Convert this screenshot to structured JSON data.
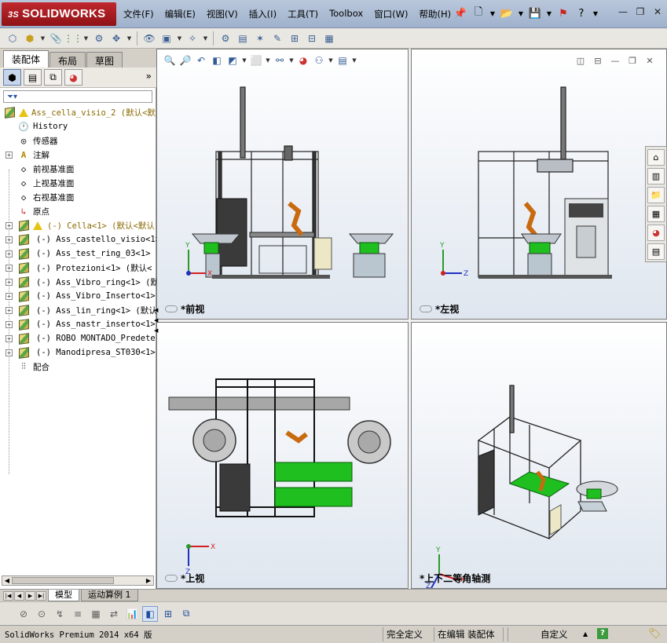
{
  "app": {
    "logo_text": "SOLIDWORKS",
    "logo_prefix": "3S"
  },
  "menu": {
    "items": [
      "文件(F)",
      "编辑(E)",
      "视图(V)",
      "插入(I)",
      "工具(T)",
      "Toolbox",
      "窗口(W)",
      "帮助(H)"
    ]
  },
  "titlebar_icons": [
    "pin-icon",
    "new-document-icon",
    "open-icon",
    "save-icon",
    "traffic-light-icon",
    "help-icon"
  ],
  "left_panel": {
    "tabs": [
      "装配体",
      "布局",
      "草图"
    ],
    "active_tab": "装配体",
    "tree": [
      {
        "label": "Ass_cella_visio_2  (默认<默",
        "icon": "assembly-icon",
        "warn": true,
        "type": "root"
      },
      {
        "label": "History",
        "icon": "history-icon"
      },
      {
        "label": "传感器",
        "icon": "sensor-icon"
      },
      {
        "label": "注解",
        "icon": "annotation-icon",
        "expand": true
      },
      {
        "label": "前视基准面",
        "icon": "plane-icon"
      },
      {
        "label": "上视基准面",
        "icon": "plane-icon"
      },
      {
        "label": "右视基准面",
        "icon": "plane-icon"
      },
      {
        "label": "原点",
        "icon": "origin-icon"
      },
      {
        "label": "(-) Cella<1> (默认<默认",
        "icon": "part-icon",
        "warn": true,
        "expand": true,
        "type": "cella"
      },
      {
        "label": "(-) Ass_castello_visio<1>",
        "icon": "part-icon",
        "expand": true
      },
      {
        "label": "(-) Ass_test_ring_03<1> (",
        "icon": "part-icon",
        "expand": true
      },
      {
        "label": "(-) Protezioni<1> (默认<",
        "icon": "part-icon",
        "expand": true
      },
      {
        "label": "(-) Ass_Vibro_ring<1> (默",
        "icon": "part-icon",
        "expand": true
      },
      {
        "label": "(-) Ass_Vibro_Inserto<1>",
        "icon": "part-icon",
        "expand": true
      },
      {
        "label": "(-) Ass_lin_ring<1> (默认",
        "icon": "part-icon",
        "expand": true
      },
      {
        "label": "(-) Ass_nastr_inserto<1>",
        "icon": "part-icon",
        "expand": true
      },
      {
        "label": "(-) ROBO MONTADO_Predeterm",
        "icon": "part-icon",
        "expand": true
      },
      {
        "label": "(-) Manodipresa_ST030<1>",
        "icon": "part-icon",
        "expand": true
      },
      {
        "label": "配合",
        "icon": "mates-icon"
      }
    ]
  },
  "viewports": {
    "front": "*前视",
    "left": "*左视",
    "top": "*上视",
    "iso": "*上下二等角轴测"
  },
  "axes": {
    "x": "X",
    "y": "Y",
    "z": "Z"
  },
  "bottom_tabs": [
    "模型",
    "运动算例 1"
  ],
  "active_bottom_tab": "模型",
  "status": {
    "product": "SolidWorks Premium 2014 x64 版",
    "defined": "完全定义",
    "mode": "在编辑 装配体",
    "custom": "自定义"
  }
}
